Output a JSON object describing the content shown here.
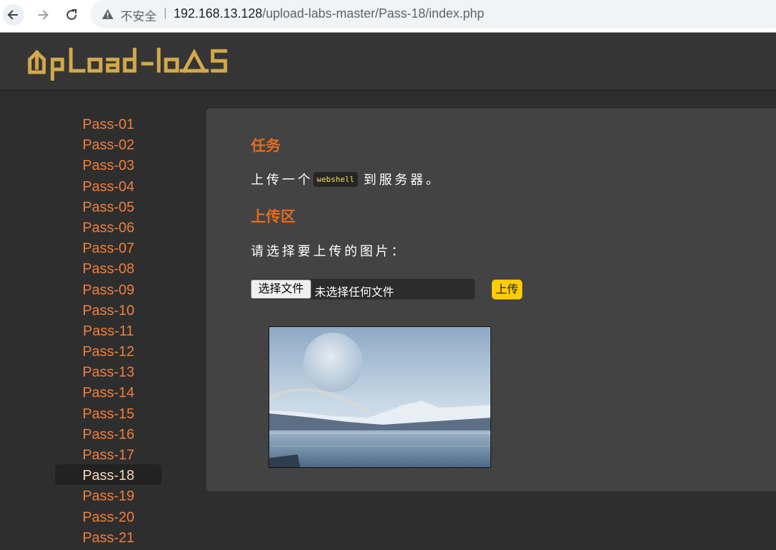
{
  "browser": {
    "insecure_label": "不安全",
    "separator": "|",
    "url_host": "192.168.13.128",
    "url_path": "/upload-labs-master/Pass-18/index.php"
  },
  "site": {
    "logo_text": "UpLoad-labs",
    "logo_color": "#d4a94a"
  },
  "sidebar": {
    "active_index": 17,
    "items": [
      {
        "label": "Pass-01"
      },
      {
        "label": "Pass-02"
      },
      {
        "label": "Pass-03"
      },
      {
        "label": "Pass-04"
      },
      {
        "label": "Pass-05"
      },
      {
        "label": "Pass-06"
      },
      {
        "label": "Pass-07"
      },
      {
        "label": "Pass-08"
      },
      {
        "label": "Pass-09"
      },
      {
        "label": "Pass-10"
      },
      {
        "label": "Pass-11"
      },
      {
        "label": "Pass-12"
      },
      {
        "label": "Pass-13"
      },
      {
        "label": "Pass-14"
      },
      {
        "label": "Pass-15"
      },
      {
        "label": "Pass-16"
      },
      {
        "label": "Pass-17"
      },
      {
        "label": "Pass-18"
      },
      {
        "label": "Pass-19"
      },
      {
        "label": "Pass-20"
      },
      {
        "label": "Pass-21"
      }
    ]
  },
  "main": {
    "task_heading": "任务",
    "task_prefix": "上传一个",
    "task_code": "webshell",
    "task_suffix": "到服务器。",
    "upload_heading": "上传区",
    "prompt": "请选择要上传的图片：",
    "choose_file_label": "选择文件",
    "file_status": "未选择任何文件",
    "submit_label": "上传"
  },
  "colors": {
    "accent_orange": "#e36b1c",
    "link_orange": "#f07f3c",
    "submit_yellow": "#ffcc00"
  }
}
